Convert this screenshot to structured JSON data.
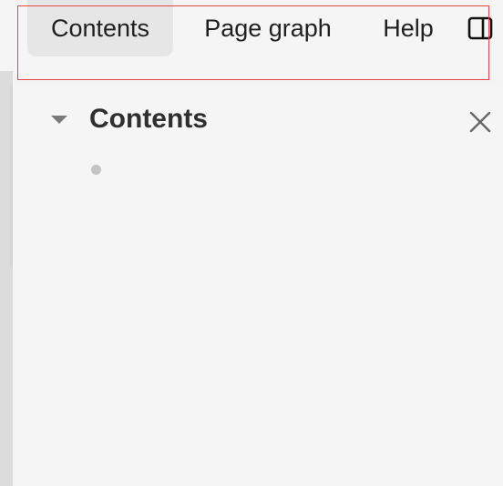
{
  "toolbar": {
    "tabs": [
      {
        "label": "Contents",
        "active": true
      },
      {
        "label": "Page graph",
        "active": false
      },
      {
        "label": "Help",
        "active": false
      }
    ],
    "panel_toggle_icon": "panel-right-icon"
  },
  "contents_panel": {
    "title": "Contents",
    "collapse_icon": "caret-down-icon",
    "close_icon": "close-icon",
    "items": [
      {
        "bullet_icon": "bullet-dot-icon",
        "label": ""
      }
    ]
  },
  "colors": {
    "background": "#f5f5f5",
    "active_tab": "#e6e6e6",
    "highlight": "#e4474b",
    "left_rail": "#dcdcdc",
    "text": "#1f1f1f"
  }
}
